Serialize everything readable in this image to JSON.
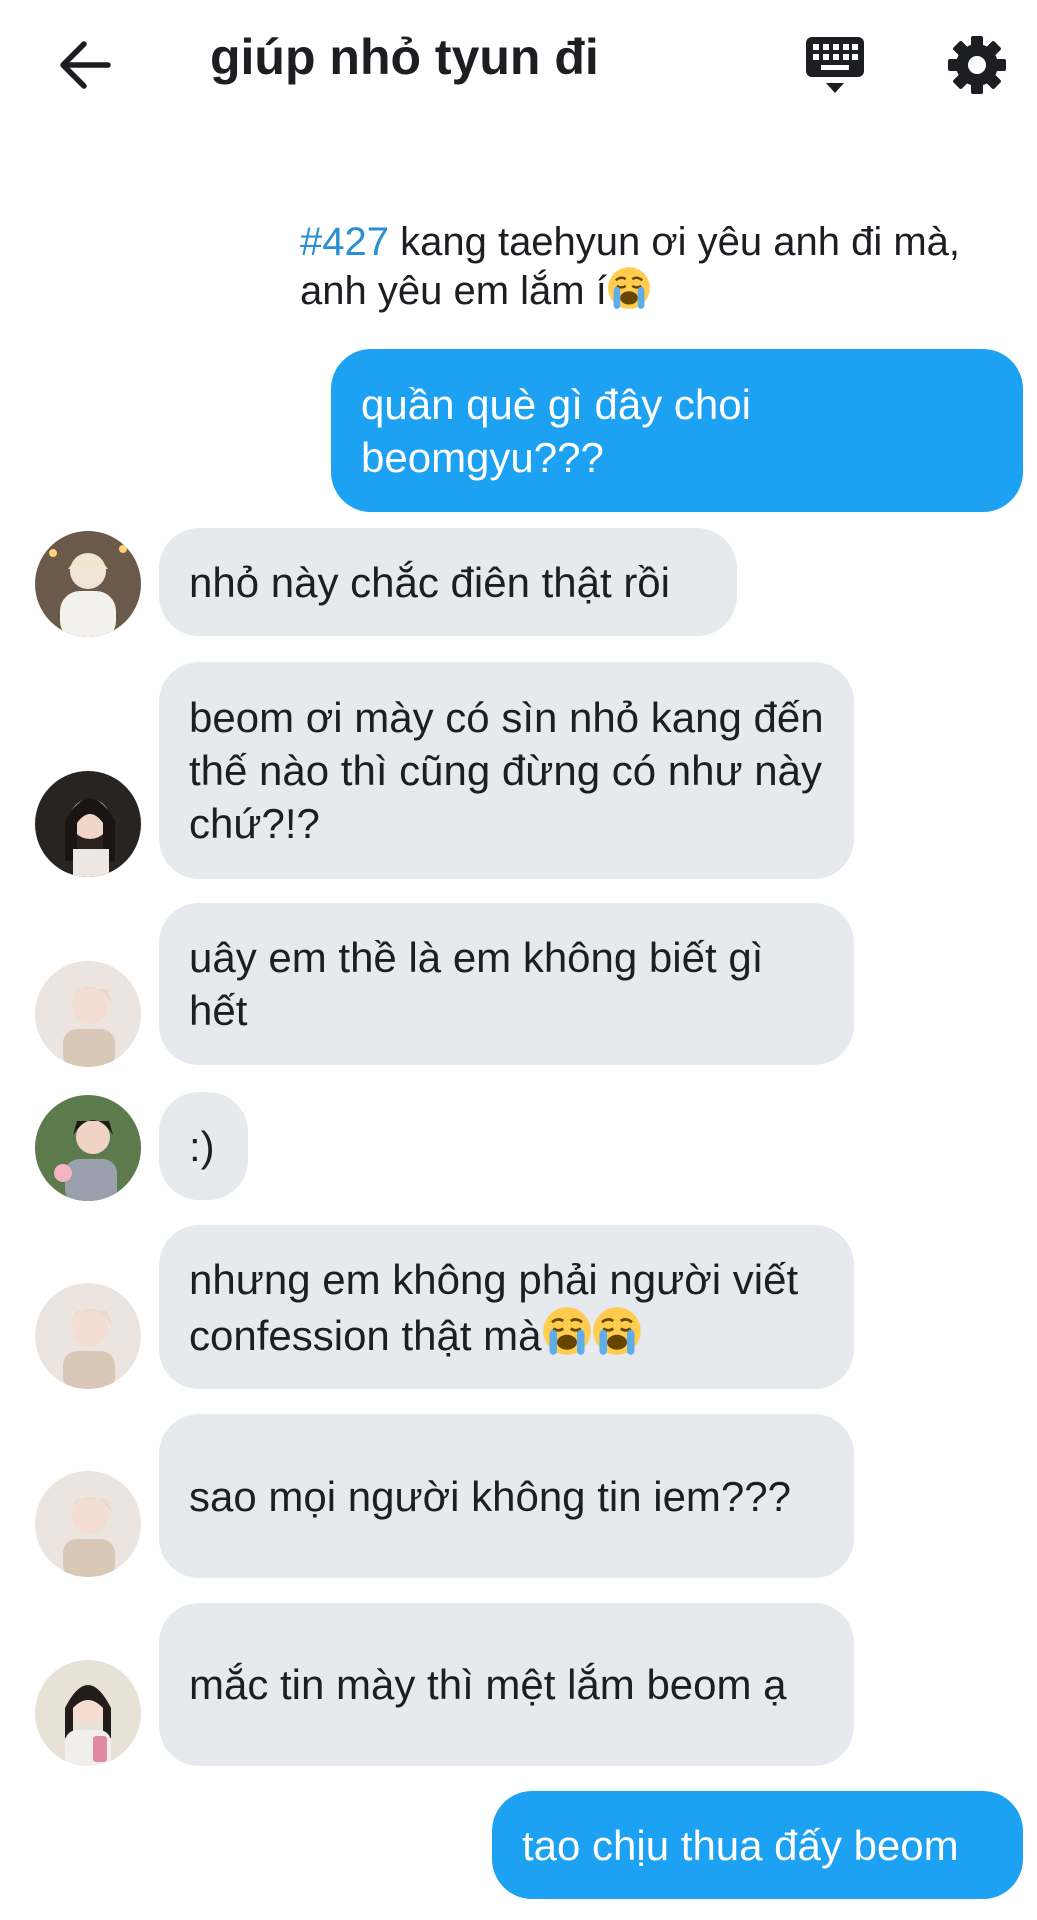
{
  "header": {
    "title": "giúp nhỏ tyun đi",
    "back_icon": "arrow-left-icon",
    "keyboard_icon": "keyboard-icon",
    "settings_icon": "gear-icon"
  },
  "confession": {
    "tag": "#427",
    "text": " kang taehyun ơi yêu anh đi mà, anh yêu em lắm í"
  },
  "messages": [
    {
      "text": "quần què gì đây choi beomgyu???"
    },
    {
      "text": "nhỏ này chắc điên thật rồi"
    },
    {
      "text": "beom ơi mày có sìn nhỏ kang đến thế nào thì cũng đừng có như này chứ?!?"
    },
    {
      "text": "uây em thề là em không biết gì hết"
    },
    {
      "text": ":)"
    },
    {
      "text": "nhưng em không phải người viết confession thật mà"
    },
    {
      "text": "sao mọi người không tin iem???"
    },
    {
      "text": "mắc tin mày thì mệt lắm beom ạ"
    },
    {
      "text": "tao chịu thua đấy beom"
    }
  ],
  "colors": {
    "accent": "#1da1f2",
    "incoming_bubble": "#e6e9ee",
    "tag": "#2a8fd0"
  }
}
